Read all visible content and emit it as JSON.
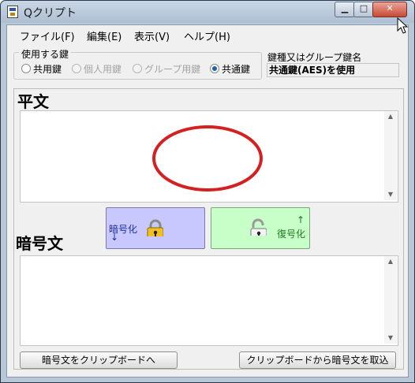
{
  "window": {
    "title": "Qクリプト"
  },
  "menu": [
    {
      "label": "ファイル(F)"
    },
    {
      "label": "編集(E)"
    },
    {
      "label": "表示(V)"
    },
    {
      "label": "ヘルプ(H)"
    }
  ],
  "key_group": {
    "legend": "使用する鍵",
    "options": [
      {
        "label": "共用鍵",
        "checked": false,
        "enabled": true
      },
      {
        "label": "個人用鍵",
        "checked": false,
        "enabled": false
      },
      {
        "label": "グループ用鍵",
        "checked": false,
        "enabled": false
      },
      {
        "label": "共通鍵",
        "checked": true,
        "enabled": true
      }
    ]
  },
  "key_type": {
    "label": "鍵種又はグループ鍵名",
    "value": "共通鍵(AES)を使用"
  },
  "plain": {
    "title": "平文",
    "text": ""
  },
  "cipher": {
    "title": "暗号文",
    "text": ""
  },
  "actions": {
    "encrypt_label": "暗号化",
    "encrypt_arrow": "↓",
    "decrypt_label": "復号化",
    "decrypt_arrow": "↑",
    "copy_to_clipboard": "暗号文をクリップボードへ",
    "paste_from_clipboard": "クリップボードから暗号文を取込"
  },
  "colors": {
    "encrypt_bg": "#c8c8ff",
    "decrypt_bg": "#c8ffc8",
    "annotation": "#d42020"
  }
}
